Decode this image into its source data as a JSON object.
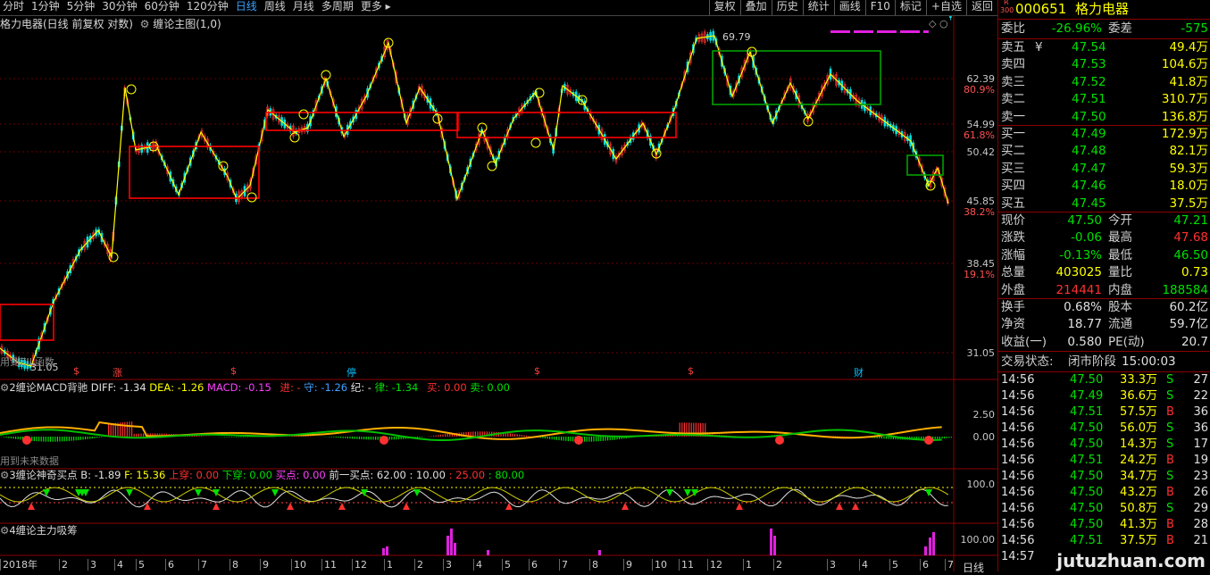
{
  "toolbar": {
    "periods": [
      "分时",
      "1分钟",
      "5分钟",
      "30分钟",
      "60分钟",
      "120分钟",
      "日线",
      "周线",
      "月线",
      "多周期",
      "更多"
    ],
    "active_period": "日线",
    "right_buttons": [
      "复权",
      "叠加",
      "历史",
      "统计",
      "画线",
      "F10",
      "标记",
      "+自选",
      "返回"
    ]
  },
  "main_chart": {
    "title": "格力电器(日线 前复权 对数)",
    "indicator": "缠论主图(1,0)",
    "peak_label": "69.79",
    "low_label": "31.05",
    "price_axis": [
      {
        "price": "62.39",
        "pct": "80.9%"
      },
      {
        "price": "54.99",
        "pct": "61.8%"
      },
      {
        "price": "50.42",
        "pct": ""
      },
      {
        "price": "45.85",
        "pct": "38.2%"
      },
      {
        "price": "38.45",
        "pct": "19.1%"
      },
      {
        "price": "31.05",
        "pct": ""
      }
    ],
    "left_note": "用到ZIL函数",
    "markers": [
      {
        "text": "$",
        "color": "#ff4040"
      },
      {
        "text": "涨",
        "color": "#ff4040"
      },
      {
        "text": "$",
        "color": "#ff4040"
      },
      {
        "text": "停",
        "color": "#00c0ff"
      },
      {
        "text": "$",
        "color": "#ff4040"
      },
      {
        "text": "$",
        "color": "#ff4040"
      },
      {
        "text": "财",
        "color": "#00c0ff"
      }
    ]
  },
  "macd_panel": {
    "prefix": "2缠论MACD背驰",
    "diff": "DIFF: -1.34",
    "dea": "DEA: -1.26",
    "macd": "MACD: -0.15",
    "extra1": "进: -",
    "extra2": "守: -1.26",
    "extra3": "纪: -",
    "extra4": "律: -1.34",
    "buy": "买: 0.00",
    "sell": "卖: 0.00",
    "axis": [
      "2.50",
      "0.00"
    ],
    "note": "用到未来数据"
  },
  "shenqi_panel": {
    "prefix": "3缠论神奇买点",
    "b": "B: -1.89",
    "f": "F: 15.36",
    "up": "上穿: 0.00",
    "down": "下穿: 0.00",
    "buypt": "买点: 0.00",
    "prev": "前一买点: 62.00",
    "v1": ": 10.00",
    "v2": ": 25.00",
    "v3": ": 80.00",
    "axis": "100.0"
  },
  "xishou_panel": {
    "prefix": "4缠论主力吸筹",
    "axis": "100.00"
  },
  "date_axis": {
    "items": [
      "2018年",
      "2",
      "3",
      "4",
      "5",
      "6",
      "7",
      "8",
      "9",
      "10",
      "11",
      "12",
      "1",
      "2",
      "3",
      "4",
      "5",
      "6",
      "7",
      "8",
      "9",
      "10",
      "11",
      "12",
      "1",
      "2",
      "3",
      "4",
      "5",
      "6",
      "7"
    ],
    "period_label": "日线"
  },
  "quote": {
    "code": "000651",
    "name": "格力电器",
    "badge_r": "R",
    "badge_n": "300",
    "weibi_label": "委比",
    "weibi": "-26.96%",
    "weicha_label": "委差",
    "weicha": "-575",
    "asks": [
      {
        "label": "卖五",
        "price": "47.54",
        "vol": "49.4万"
      },
      {
        "label": "卖四",
        "price": "47.53",
        "vol": "104.6万"
      },
      {
        "label": "卖三",
        "price": "47.52",
        "vol": "41.8万"
      },
      {
        "label": "卖二",
        "price": "47.51",
        "vol": "310.7万"
      },
      {
        "label": "卖一",
        "price": "47.50",
        "vol": "136.8万"
      }
    ],
    "ask5_sym": "¥",
    "bids": [
      {
        "label": "买一",
        "price": "47.49",
        "vol": "172.9万"
      },
      {
        "label": "买二",
        "price": "47.48",
        "vol": "82.1万"
      },
      {
        "label": "买三",
        "price": "47.47",
        "vol": "59.3万"
      },
      {
        "label": "买四",
        "price": "47.46",
        "vol": "18.0万"
      },
      {
        "label": "买五",
        "price": "47.45",
        "vol": "37.5万"
      }
    ],
    "stats": [
      {
        "l1": "现价",
        "v1": "47.50",
        "c1": "g",
        "l2": "今开",
        "v2": "47.21",
        "c2": "g"
      },
      {
        "l1": "涨跌",
        "v1": "-0.06",
        "c1": "g",
        "l2": "最高",
        "v2": "47.68",
        "c2": "r"
      },
      {
        "l1": "涨幅",
        "v1": "-0.13%",
        "c1": "g",
        "l2": "最低",
        "v2": "46.50",
        "c2": "g"
      },
      {
        "l1": "总量",
        "v1": "403025",
        "c1": "y",
        "l2": "量比",
        "v2": "0.73",
        "c2": "y"
      },
      {
        "l1": "外盘",
        "v1": "214441",
        "c1": "r",
        "l2": "内盘",
        "v2": "188584",
        "c2": "g"
      }
    ],
    "fund": [
      {
        "l1": "换手",
        "v1": "0.68%",
        "l2": "股本",
        "v2": "60.2亿"
      },
      {
        "l1": "净资",
        "v1": "18.77",
        "l2": "流通",
        "v2": "59.7亿"
      },
      {
        "l1": "收益(一)",
        "v1": "0.580",
        "l2": "PE(动)",
        "v2": "20.7"
      }
    ],
    "trade_state_label": "交易状态:",
    "trade_state": "闭市阶段",
    "trade_time": "15:00:03"
  },
  "ticks": [
    {
      "t": "14:56",
      "p": "47.50",
      "v": "33.3万",
      "s": "S",
      "n": "27"
    },
    {
      "t": "14:56",
      "p": "47.49",
      "v": "36.6万",
      "s": "S",
      "n": "22"
    },
    {
      "t": "14:56",
      "p": "47.51",
      "v": "57.5万",
      "s": "B",
      "n": "36"
    },
    {
      "t": "14:56",
      "p": "47.50",
      "v": "56.0万",
      "s": "S",
      "n": "36"
    },
    {
      "t": "14:56",
      "p": "47.50",
      "v": "14.3万",
      "s": "S",
      "n": "17"
    },
    {
      "t": "14:56",
      "p": "47.51",
      "v": "24.2万",
      "s": "B",
      "n": "19"
    },
    {
      "t": "14:56",
      "p": "47.50",
      "v": "34.7万",
      "s": "S",
      "n": "23"
    },
    {
      "t": "14:56",
      "p": "47.50",
      "v": "43.2万",
      "s": "B",
      "n": "26"
    },
    {
      "t": "14:56",
      "p": "47.50",
      "v": "50.8万",
      "s": "S",
      "n": "29"
    },
    {
      "t": "14:56",
      "p": "47.50",
      "v": "41.3万",
      "s": "B",
      "n": "28"
    },
    {
      "t": "14:56",
      "p": "47.51",
      "v": "37.5万",
      "s": "B",
      "n": "21"
    },
    {
      "t": "14:57",
      "p": "",
      "v": "",
      "s": "",
      "n": ""
    }
  ],
  "watermark": "jutuzhuan.com",
  "colors": {
    "up": "#ff3030",
    "down": "#00e000",
    "line": "#ffff00",
    "box_red": "#ff0000",
    "box_green": "#00a000"
  }
}
